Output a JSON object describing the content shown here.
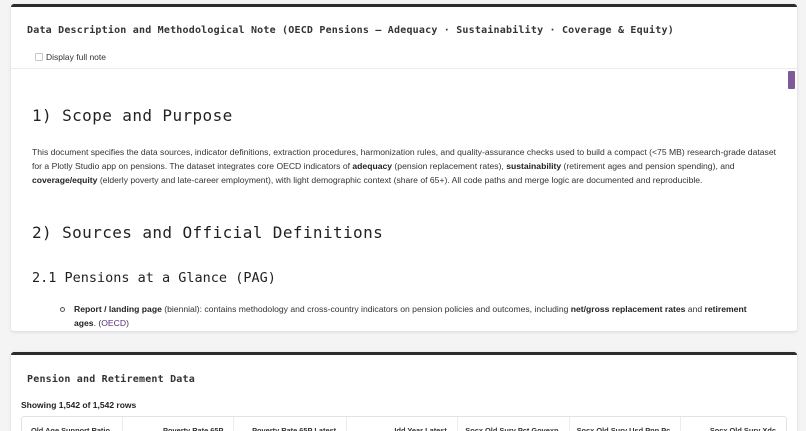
{
  "note_card": {
    "title": "Data Description and Methodological Note (OECD Pensions — Adequacy · Sustainability · Coverage & Equity)",
    "toggle_label": "Display full note",
    "section1_heading": "1) Scope and Purpose",
    "section1_body": {
      "p1": "This document specifies the data sources, indicator definitions, extraction procedures, harmonization rules, and quality-assurance checks used to build a compact (<75 MB) research-grade dataset for a Plotly Studio app on pensions. The dataset integrates core OECD indicators of ",
      "b1": "adequacy",
      "p2": " (pension replacement rates), ",
      "b2": "sustainability",
      "p3": " (retirement ages and pension spending), and ",
      "b3": "coverage/equity",
      "p4": " (elderly poverty and late-career employment), with light demographic context (share of 65+). All code paths and merge logic are documented and reproducible."
    },
    "section2_heading": "2) Sources and Official Definitions",
    "section21_heading": "2.1 Pensions at a Glance (PAG)",
    "bullet1": {
      "b1": "Report / landing page",
      "t1": " (biennial): contains methodology and cross-country indicators on pension policies and outcomes, including ",
      "b2": "net/gross replacement rates",
      "t2": " and ",
      "b3": "retirement ages",
      "t3": ". (",
      "link": "OECD",
      "t4": ")"
    }
  },
  "data_card": {
    "title": "Pension and Retirement Data",
    "rows_count": "Showing 1,542 of 1,542 rows",
    "columns": [
      "Old Age Support Ratio",
      "Poverty Rate 65P",
      "Poverty Rate 65P Latest",
      "Idd Year Latest",
      "Socx Old Surv Pct Govexp",
      "Socx Old Surv Usd Ppp Pc",
      "Socx Old Surv Xdc"
    ]
  },
  "colors": {
    "card_border": "#2c2c2c",
    "link": "#5a2d82",
    "scroll_thumb": "#7e5a9b",
    "background": "#f4f4f5"
  }
}
